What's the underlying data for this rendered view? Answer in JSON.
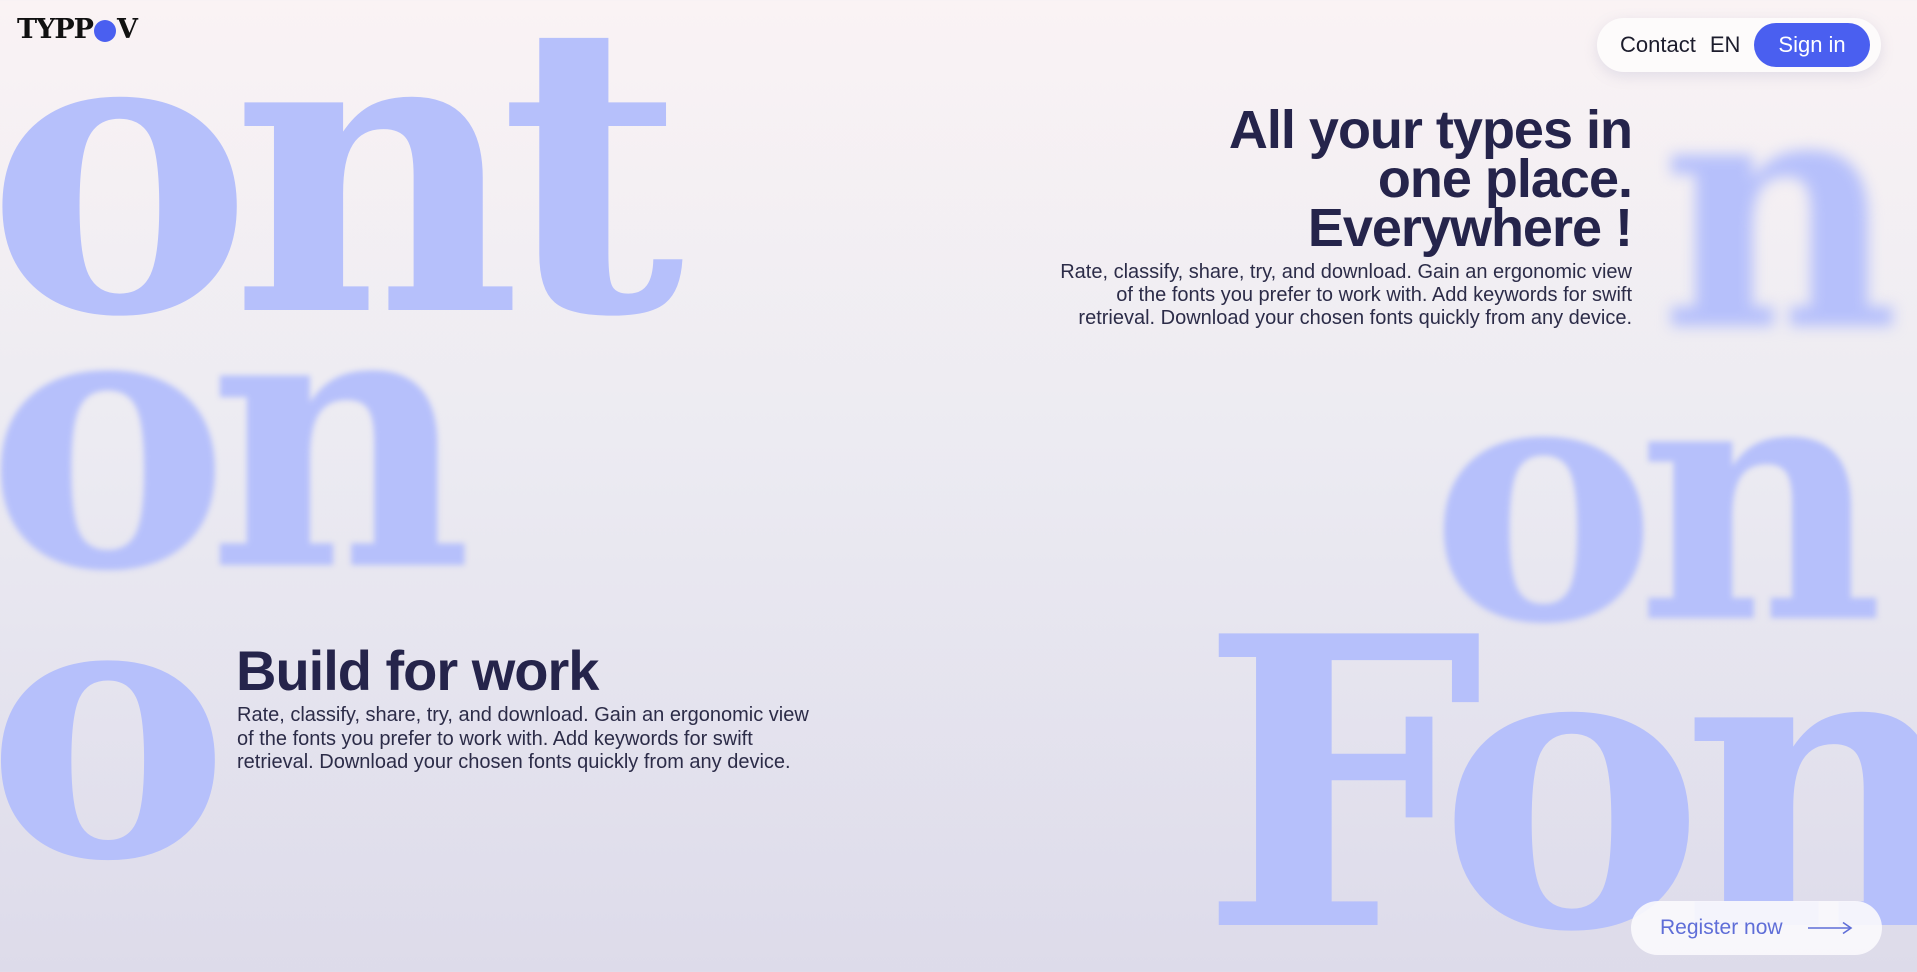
{
  "decor": {
    "words": {
      "top_left": "ont",
      "mid_left": "on",
      "low_left": "o",
      "top_right": "n",
      "mid_right": "on",
      "low_right": "Fon"
    },
    "color": "#b6c0fb"
  },
  "header": {
    "logo_left": "TYPP",
    "logo_right": "V",
    "logo_dot_color": "#4a5ff0",
    "nav": {
      "contact": "Contact",
      "language": "EN",
      "sign_in": "Sign in"
    }
  },
  "hero": {
    "title_lines": [
      "All your types in",
      "one place.",
      "Everywhere !"
    ],
    "description_lines": [
      "Rate, classify, share, try, and download. Gain an ergonomic view",
      "of the fonts you prefer to work with. Add keywords for swift",
      "retrieval. Download your chosen fonts quickly from any device."
    ]
  },
  "feature": {
    "title": "Build for work",
    "description_lines": [
      "Rate, classify, share, try, and download. Gain an ergonomic view",
      "of the fonts you prefer to work with. Add keywords for swift",
      "retrieval. Download your chosen fonts quickly from any device."
    ]
  },
  "cta": {
    "register_label": "Register now",
    "arrow_icon": "arrow-right-icon"
  },
  "colors": {
    "accent": "#4a5ff0",
    "heading": "#25244b",
    "decor": "#b6c0fb"
  }
}
